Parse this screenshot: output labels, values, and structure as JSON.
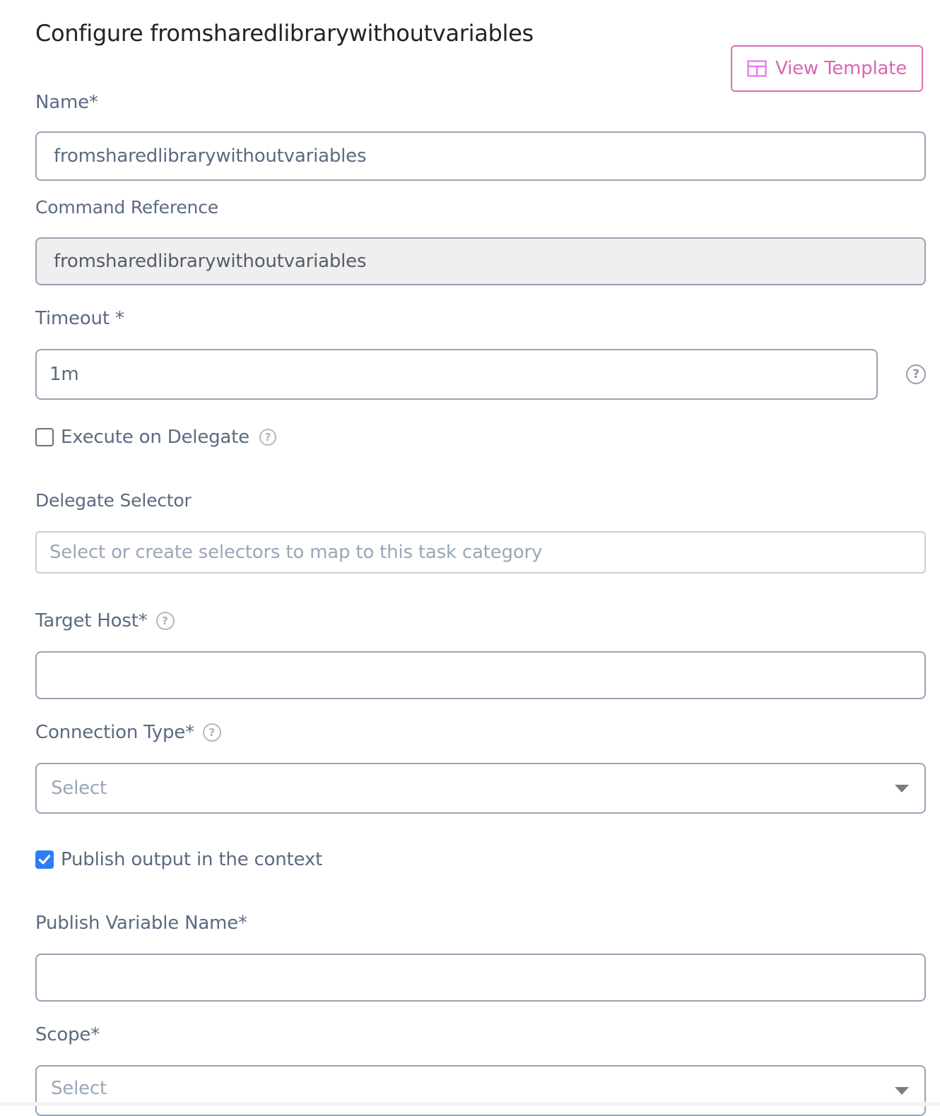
{
  "header": {
    "title": "Configure fromsharedlibrarywithoutvariables",
    "view_template_label": "View Template",
    "view_template_icon": "template-layout-icon"
  },
  "colors": {
    "accent_pink": "#d867b2",
    "checkbox_blue": "#2f7cf6",
    "label_slate": "#5b6a82"
  },
  "form": {
    "name": {
      "label": "Name*",
      "value": "fromsharedlibrarywithoutvariables"
    },
    "command_reference": {
      "label": "Command Reference",
      "value": "fromsharedlibrarywithoutvariables",
      "readonly": true
    },
    "timeout": {
      "label": "Timeout *",
      "value": "1m",
      "help_icon": "question-circle-icon"
    },
    "execute_on_delegate": {
      "label": "Execute on Delegate",
      "checked": false,
      "help_icon": "question-circle-icon"
    },
    "delegate_selector": {
      "label": "Delegate Selector",
      "placeholder": "Select or create selectors to map to this task category",
      "value": ""
    },
    "target_host": {
      "label": "Target Host*",
      "value": "",
      "help_icon": "question-circle-icon"
    },
    "connection_type": {
      "label": "Connection Type*",
      "placeholder": "Select",
      "help_icon": "question-circle-icon"
    },
    "publish_output": {
      "label": "Publish output in the context",
      "checked": true
    },
    "publish_variable_name": {
      "label": "Publish Variable Name*",
      "value": ""
    },
    "scope": {
      "label": "Scope*",
      "placeholder": "Select"
    }
  },
  "glyphs": {
    "help": "?",
    "check": "✓"
  }
}
